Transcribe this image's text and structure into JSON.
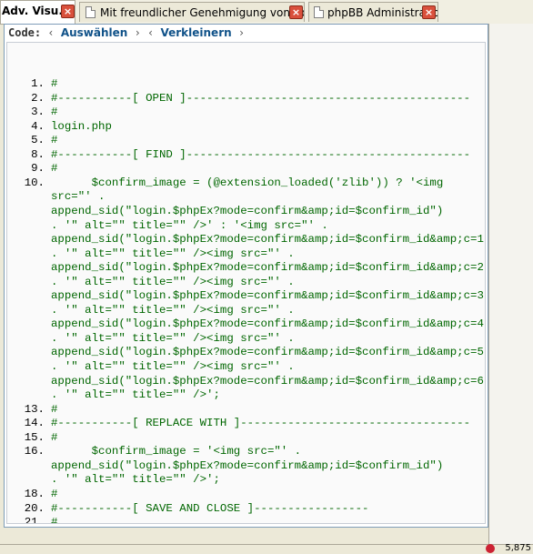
{
  "tabs": [
    {
      "label": "Adv. Visu...",
      "active": true
    },
    {
      "label": "Mit freundlicher Genehmigung von Udo ...",
      "active": false
    },
    {
      "label": "phpBB Administration",
      "active": false
    }
  ],
  "close_glyph": "×",
  "code_header": {
    "label": "Code:",
    "sep1": "‹",
    "select_all": "Auswählen",
    "sep2": "› ‹",
    "shrink": "Verkleinern",
    "sep3": "›"
  },
  "code_lines": [
    {
      "num": "1.",
      "text": "#"
    },
    {
      "num": "2.",
      "text": "#-----------[ OPEN ]------------------------------------------"
    },
    {
      "num": "3.",
      "text": "#"
    },
    {
      "num": "4.",
      "text": "login.php"
    },
    {
      "num": "5.",
      "text": "#"
    },
    {
      "num": "8.",
      "text": "#-----------[ FIND ]------------------------------------------"
    },
    {
      "num": "9.",
      "text": "#"
    },
    {
      "num": "10.",
      "text": "      $confirm_image = (@extension_loaded('zlib')) ? '<img"
    },
    {
      "num": "",
      "text": "src=\"' ."
    },
    {
      "num": "",
      "text": "append_sid(\"login.$phpEx?mode=confirm&amp;id=$confirm_id\")"
    },
    {
      "num": "",
      "text": ". '\" alt=\"\" title=\"\" />' : '<img src=\"' ."
    },
    {
      "num": "",
      "text": "append_sid(\"login.$phpEx?mode=confirm&amp;id=$confirm_id&amp;c=1\")"
    },
    {
      "num": "",
      "text": ". '\" alt=\"\" title=\"\" /><img src=\"' ."
    },
    {
      "num": "",
      "text": "append_sid(\"login.$phpEx?mode=confirm&amp;id=$confirm_id&amp;c=2\")"
    },
    {
      "num": "",
      "text": ". '\" alt=\"\" title=\"\" /><img src=\"' ."
    },
    {
      "num": "",
      "text": "append_sid(\"login.$phpEx?mode=confirm&amp;id=$confirm_id&amp;c=3\")"
    },
    {
      "num": "",
      "text": ". '\" alt=\"\" title=\"\" /><img src=\"' ."
    },
    {
      "num": "",
      "text": "append_sid(\"login.$phpEx?mode=confirm&amp;id=$confirm_id&amp;c=4\")"
    },
    {
      "num": "",
      "text": ". '\" alt=\"\" title=\"\" /><img src=\"' ."
    },
    {
      "num": "",
      "text": "append_sid(\"login.$phpEx?mode=confirm&amp;id=$confirm_id&amp;c=5\")"
    },
    {
      "num": "",
      "text": ". '\" alt=\"\" title=\"\" /><img src=\"' ."
    },
    {
      "num": "",
      "text": "append_sid(\"login.$phpEx?mode=confirm&amp;id=$confirm_id&amp;c=6\")"
    },
    {
      "num": "",
      "text": ". '\" alt=\"\" title=\"\" />';"
    },
    {
      "num": "13.",
      "text": "#"
    },
    {
      "num": "14.",
      "text": "#-----------[ REPLACE WITH ]----------------------------------"
    },
    {
      "num": "15.",
      "text": "#"
    },
    {
      "num": "16.",
      "text": "      $confirm_image = '<img src=\"' ."
    },
    {
      "num": "",
      "text": "append_sid(\"login.$phpEx?mode=confirm&amp;id=$confirm_id\")"
    },
    {
      "num": "",
      "text": ". '\" alt=\"\" title=\"\" />';"
    },
    {
      "num": "18.",
      "text": "#"
    },
    {
      "num": "20.",
      "text": "#-----------[ SAVE AND CLOSE ]-----------------"
    },
    {
      "num": "21.",
      "text": "#"
    }
  ],
  "colors": {
    "code_text": "#006600",
    "link": "#105289"
  },
  "status": {
    "zoom_text": "5,875"
  }
}
